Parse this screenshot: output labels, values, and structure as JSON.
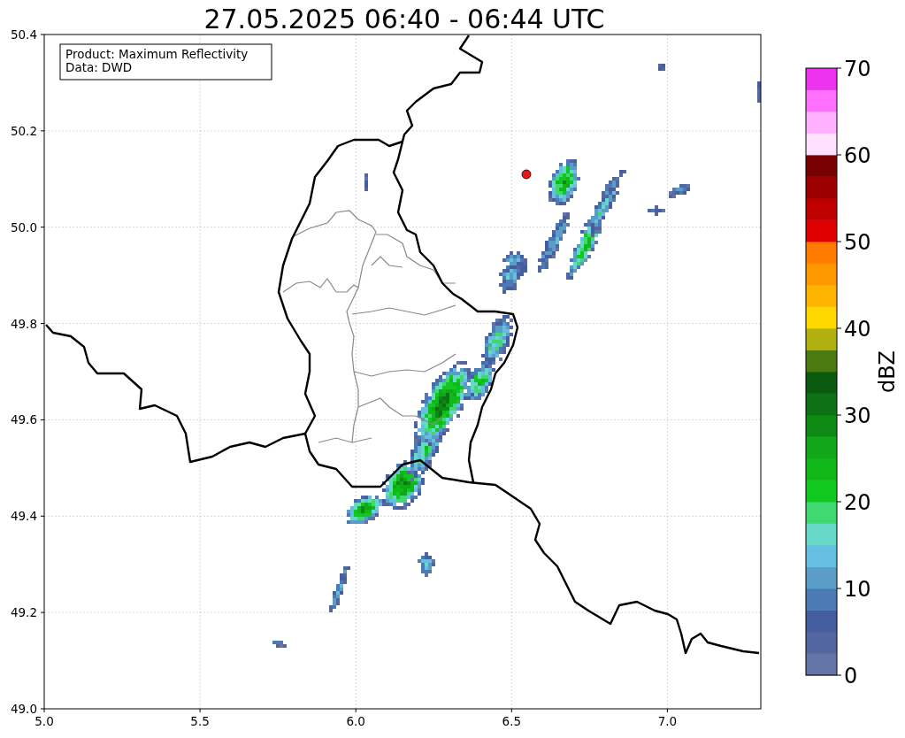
{
  "title": "27.05.2025 06:40 - 06:44 UTC",
  "info_box": [
    "Product: Maximum Reflectivity",
    "Data: DWD"
  ],
  "map": {
    "yticks": [
      "50.4",
      "50.2",
      "50.0",
      "49.8",
      "49.6",
      "49.4",
      "49.2",
      "49.0"
    ],
    "xticks": [
      "5.0",
      "5.5",
      "6.0",
      "6.5",
      "7.0"
    ]
  },
  "colorbar": {
    "label": "dBZ",
    "ticks": [
      "70",
      "60",
      "50",
      "40",
      "30",
      "20",
      "10",
      "0"
    ]
  }
}
